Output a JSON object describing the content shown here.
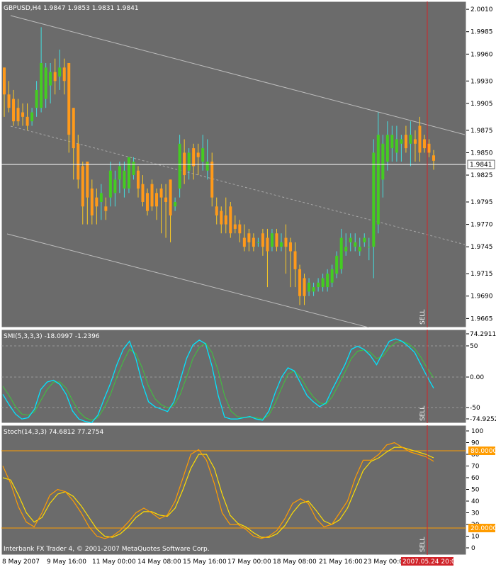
{
  "app": "Interbank FX Trader 4, © 2001-2007 MetaQuotes Software Corp.",
  "colors": {
    "bg": "#6b6b6b",
    "frame": "#ffffff",
    "bull": "#44cc22",
    "bear": "#ff9a1a",
    "wick_up": "#44dddd",
    "wick_down": "#ffcc22",
    "smi_main": "#00e5ff",
    "smi_signal": "#3cc83c",
    "stoch_main": "#ff9c00",
    "stoch_signal": "#ffdd00",
    "level": "#ff9c00",
    "sell_line": "#d0242a",
    "channel": "#bdbdbd"
  },
  "main_panel": {
    "header": "GBPUSD,H4  1.9847 1.9853 1.9831 1.9841",
    "current_price": "1.9841",
    "sell_label": "SELL",
    "price_ticks": [
      "2.0010",
      "1.9985",
      "1.9960",
      "1.9930",
      "1.9905",
      "1.9875",
      "1.9850",
      "1.9825",
      "1.9795",
      "1.9770",
      "1.9745",
      "1.9715",
      "1.9690",
      "1.9665"
    ]
  },
  "smi_panel": {
    "header": "SMI(5,3,3,3) -18.0997 -1.2396",
    "ticks": [
      "74.2911",
      "50",
      "0.00",
      "-50",
      "-74.9252"
    ],
    "sell_label": "SELL"
  },
  "stoch_panel": {
    "header": "Stoch(14,3,3) 74.6812 77.2754",
    "ticks": [
      "100",
      "90",
      "80",
      "70",
      "60",
      "50",
      "40",
      "30",
      "20",
      "10",
      "0"
    ],
    "level_labels": [
      "80.0000",
      "20.0000"
    ],
    "sell_label": "SELL"
  },
  "time_axis": {
    "labels": [
      "8 May 2007",
      "9 May 16:00",
      "11 May 00:00",
      "14 May 08:00",
      "15 May 16:00",
      "17 May 00:00",
      "18 May 08:00",
      "21 May 16:00",
      "23 May 00:00"
    ],
    "current_time": "2007.05.24 20:00"
  },
  "chart_data": {
    "type": "candlestick",
    "symbol": "GBPUSD",
    "timeframe": "H4",
    "price_range": [
      1.9655,
      2.0018
    ],
    "candles": [
      [
        1.9945,
        1.9945,
        1.989,
        1.9915
      ],
      [
        1.9915,
        1.993,
        1.9895,
        1.99
      ],
      [
        1.991,
        1.992,
        1.988,
        1.9885
      ],
      [
        1.99,
        1.991,
        1.988,
        1.9885
      ],
      [
        1.9895,
        1.9905,
        1.988,
        1.989
      ],
      [
        1.989,
        1.9905,
        1.9875,
        1.988
      ],
      [
        1.9885,
        1.99,
        1.988,
        1.9895
      ],
      [
        1.99,
        1.993,
        1.989,
        1.992
      ],
      [
        1.99,
        1.999,
        1.9895,
        1.995
      ],
      [
        1.991,
        1.995,
        1.99,
        1.9945
      ],
      [
        1.9925,
        1.995,
        1.9905,
        1.994
      ],
      [
        1.994,
        1.9955,
        1.9915,
        1.993
      ],
      [
        1.9935,
        1.9965,
        1.992,
        1.9945
      ],
      [
        1.9945,
        1.9955,
        1.9915,
        1.993
      ],
      [
        1.995,
        1.995,
        1.985,
        1.987
      ],
      [
        1.99,
        1.99,
        1.982,
        1.9855
      ],
      [
        1.986,
        1.987,
        1.981,
        1.982
      ],
      [
        1.9835,
        1.984,
        1.977,
        1.979
      ],
      [
        1.984,
        1.984,
        1.977,
        1.98
      ],
      [
        1.981,
        1.982,
        1.977,
        1.978
      ],
      [
        1.98,
        1.981,
        1.977,
        1.979
      ],
      [
        1.9795,
        1.9815,
        1.9775,
        1.9805
      ],
      [
        1.979,
        1.98,
        1.9775,
        1.9785
      ],
      [
        1.98,
        1.984,
        1.979,
        1.983
      ],
      [
        1.9805,
        1.983,
        1.979,
        1.982
      ],
      [
        1.982,
        1.984,
        1.9805,
        1.9835
      ],
      [
        1.981,
        1.984,
        1.98,
        1.983
      ],
      [
        1.981,
        1.9845,
        1.9805,
        1.9845
      ],
      [
        1.9825,
        1.9845,
        1.982,
        1.984
      ],
      [
        1.983,
        1.9835,
        1.98,
        1.981
      ],
      [
        1.9815,
        1.9825,
        1.979,
        1.9795
      ],
      [
        1.9805,
        1.981,
        1.978,
        1.9785
      ],
      [
        1.9815,
        1.982,
        1.9785,
        1.979
      ],
      [
        1.9805,
        1.981,
        1.9775,
        1.979
      ],
      [
        1.981,
        1.9815,
        1.976,
        1.98
      ],
      [
        1.98,
        1.9815,
        1.9755,
        1.9795
      ],
      [
        1.982,
        1.982,
        1.975,
        1.978
      ],
      [
        1.979,
        1.98,
        1.9785,
        1.9795
      ],
      [
        1.981,
        1.987,
        1.98,
        1.986
      ],
      [
        1.985,
        1.9865,
        1.9815,
        1.9825
      ],
      [
        1.983,
        1.9855,
        1.982,
        1.985
      ],
      [
        1.9855,
        1.986,
        1.982,
        1.9835
      ],
      [
        1.985,
        1.986,
        1.9825,
        1.9845
      ],
      [
        1.984,
        1.987,
        1.983,
        1.9855
      ],
      [
        1.983,
        1.9865,
        1.982,
        1.984
      ],
      [
        1.984,
        1.985,
        1.979,
        1.98
      ],
      [
        1.979,
        1.98,
        1.977,
        1.978
      ],
      [
        1.9785,
        1.979,
        1.976,
        1.977
      ],
      [
        1.978,
        1.98,
        1.976,
        1.977
      ],
      [
        1.979,
        1.9795,
        1.9755,
        1.976
      ],
      [
        1.977,
        1.978,
        1.976,
        1.9765
      ],
      [
        1.977,
        1.9775,
        1.975,
        1.976
      ],
      [
        1.9755,
        1.977,
        1.974,
        1.9745
      ],
      [
        1.976,
        1.9765,
        1.974,
        1.975
      ],
      [
        1.9755,
        1.976,
        1.974,
        1.9745
      ],
      [
        1.975,
        1.9755,
        1.9745,
        1.975
      ],
      [
        1.976,
        1.9765,
        1.9735,
        1.9745
      ],
      [
        1.9755,
        1.9765,
        1.97,
        1.974
      ],
      [
        1.9745,
        1.9765,
        1.974,
        1.976
      ],
      [
        1.976,
        1.9765,
        1.974,
        1.9745
      ],
      [
        1.9745,
        1.976,
        1.974,
        1.975
      ],
      [
        1.9755,
        1.977,
        1.9715,
        1.9745
      ],
      [
        1.975,
        1.9755,
        1.97,
        1.974
      ],
      [
        1.974,
        1.975,
        1.97,
        1.972
      ],
      [
        1.972,
        1.9725,
        1.968,
        1.969
      ],
      [
        1.971,
        1.9715,
        1.968,
        1.969
      ],
      [
        1.9695,
        1.971,
        1.969,
        1.9705
      ],
      [
        1.9695,
        1.9705,
        1.969,
        1.97
      ],
      [
        1.97,
        1.971,
        1.9695,
        1.9705
      ],
      [
        1.97,
        1.9715,
        1.9695,
        1.971
      ],
      [
        1.97,
        1.972,
        1.9695,
        1.9715
      ],
      [
        1.9705,
        1.9725,
        1.97,
        1.972
      ],
      [
        1.9715,
        1.974,
        1.971,
        1.9735
      ],
      [
        1.972,
        1.9765,
        1.9715,
        1.9755
      ],
      [
        1.974,
        1.976,
        1.9735,
        1.9745
      ],
      [
        1.975,
        1.976,
        1.974,
        1.9755
      ],
      [
        1.9745,
        1.976,
        1.974,
        1.975
      ],
      [
        1.974,
        1.9755,
        1.9735,
        1.9745
      ],
      [
        1.975,
        1.976,
        1.9745,
        1.9755
      ],
      [
        1.9745,
        1.9755,
        1.973,
        1.9745
      ],
      [
        1.9745,
        1.9865,
        1.971,
        1.985
      ],
      [
        1.977,
        1.9895,
        1.976,
        1.987
      ],
      [
        1.982,
        1.987,
        1.98,
        1.986
      ],
      [
        1.984,
        1.9885,
        1.983,
        1.987
      ],
      [
        1.9855,
        1.988,
        1.984,
        1.987
      ],
      [
        1.985,
        1.988,
        1.984,
        1.9865
      ],
      [
        1.986,
        1.987,
        1.984,
        1.9865
      ],
      [
        1.987,
        1.988,
        1.985,
        1.9855
      ],
      [
        1.986,
        1.9885,
        1.9835,
        1.987
      ],
      [
        1.9865,
        1.9875,
        1.984,
        1.986
      ],
      [
        1.988,
        1.989,
        1.984,
        1.985
      ],
      [
        1.9865,
        1.987,
        1.985,
        1.9855
      ],
      [
        1.986,
        1.9865,
        1.9845,
        1.985
      ],
      [
        1.9847,
        1.9853,
        1.9831,
        1.9841
      ]
    ],
    "smi_main": [
      -28,
      -45,
      -60,
      -68,
      -66,
      -52,
      -20,
      -8,
      -5,
      -12,
      -28,
      -55,
      -68,
      -72,
      -74,
      -62,
      -35,
      -10,
      20,
      45,
      58,
      30,
      -10,
      -40,
      -48,
      -52,
      -56,
      -40,
      -5,
      30,
      52,
      60,
      54,
      18,
      -30,
      -65,
      -68,
      -68,
      -66,
      -64,
      -68,
      -70,
      -55,
      -25,
      0,
      15,
      10,
      -10,
      -30,
      -40,
      -48,
      -42,
      -20,
      0,
      20,
      45,
      50,
      45,
      35,
      20,
      40,
      58,
      62,
      58,
      50,
      40,
      20,
      0,
      -18
    ],
    "smi_signal": [
      -15,
      -30,
      -48,
      -60,
      -62,
      -56,
      -38,
      -20,
      -8,
      -8,
      -18,
      -38,
      -56,
      -66,
      -70,
      -66,
      -50,
      -28,
      0,
      25,
      45,
      38,
      15,
      -15,
      -35,
      -45,
      -50,
      -46,
      -28,
      0,
      30,
      48,
      55,
      40,
      10,
      -30,
      -55,
      -64,
      -66,
      -65,
      -66,
      -68,
      -62,
      -42,
      -18,
      5,
      10,
      0,
      -18,
      -32,
      -42,
      -44,
      -32,
      -12,
      8,
      30,
      42,
      44,
      40,
      30,
      34,
      48,
      56,
      58,
      54,
      46,
      32,
      14,
      -1
    ],
    "stoch_main": [
      70,
      55,
      35,
      22,
      18,
      30,
      45,
      50,
      48,
      40,
      30,
      18,
      10,
      8,
      10,
      15,
      22,
      30,
      34,
      30,
      25,
      28,
      40,
      60,
      80,
      84,
      75,
      55,
      30,
      20,
      20,
      16,
      10,
      8,
      10,
      15,
      25,
      38,
      42,
      38,
      25,
      18,
      20,
      30,
      40,
      60,
      75,
      75,
      80,
      88,
      90,
      86,
      82,
      80,
      78,
      74
    ],
    "stoch_signal": [
      60,
      58,
      45,
      30,
      22,
      26,
      38,
      46,
      48,
      44,
      36,
      26,
      16,
      10,
      9,
      12,
      18,
      26,
      31,
      31,
      28,
      27,
      34,
      50,
      68,
      80,
      80,
      68,
      46,
      28,
      21,
      18,
      13,
      9,
      9,
      12,
      19,
      30,
      38,
      40,
      32,
      23,
      20,
      24,
      34,
      50,
      66,
      74,
      77,
      82,
      86,
      86,
      84,
      82,
      80,
      77
    ],
    "stoch_levels": [
      80,
      20
    ]
  }
}
